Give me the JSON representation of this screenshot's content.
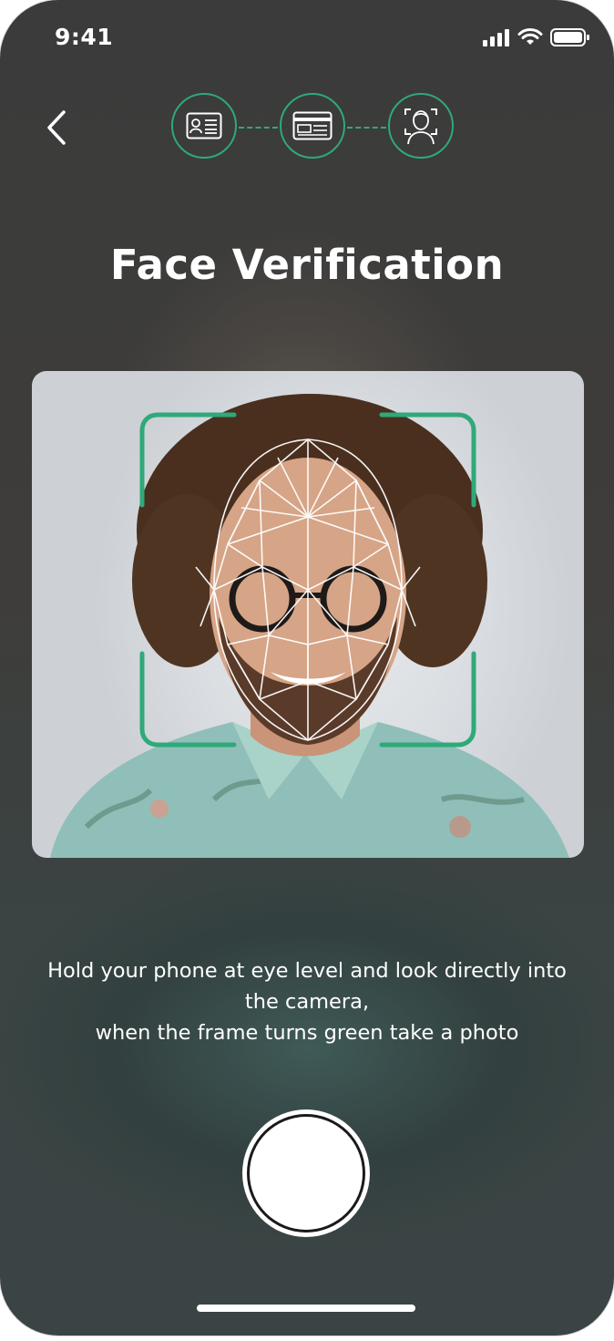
{
  "status_bar": {
    "time": "9:41"
  },
  "header": {
    "back_icon": "chevron-left-icon"
  },
  "steps": [
    {
      "icon": "id-card-icon"
    },
    {
      "icon": "document-card-icon"
    },
    {
      "icon": "face-scan-icon"
    }
  ],
  "title": "Face Verification",
  "instructions": {
    "line1": "Hold your phone at eye level and look directly into",
    "line2": "the camera,",
    "line3": "when the frame turns green take a photo"
  },
  "colors": {
    "accent": "#2fa97a",
    "text": "#ffffff"
  }
}
